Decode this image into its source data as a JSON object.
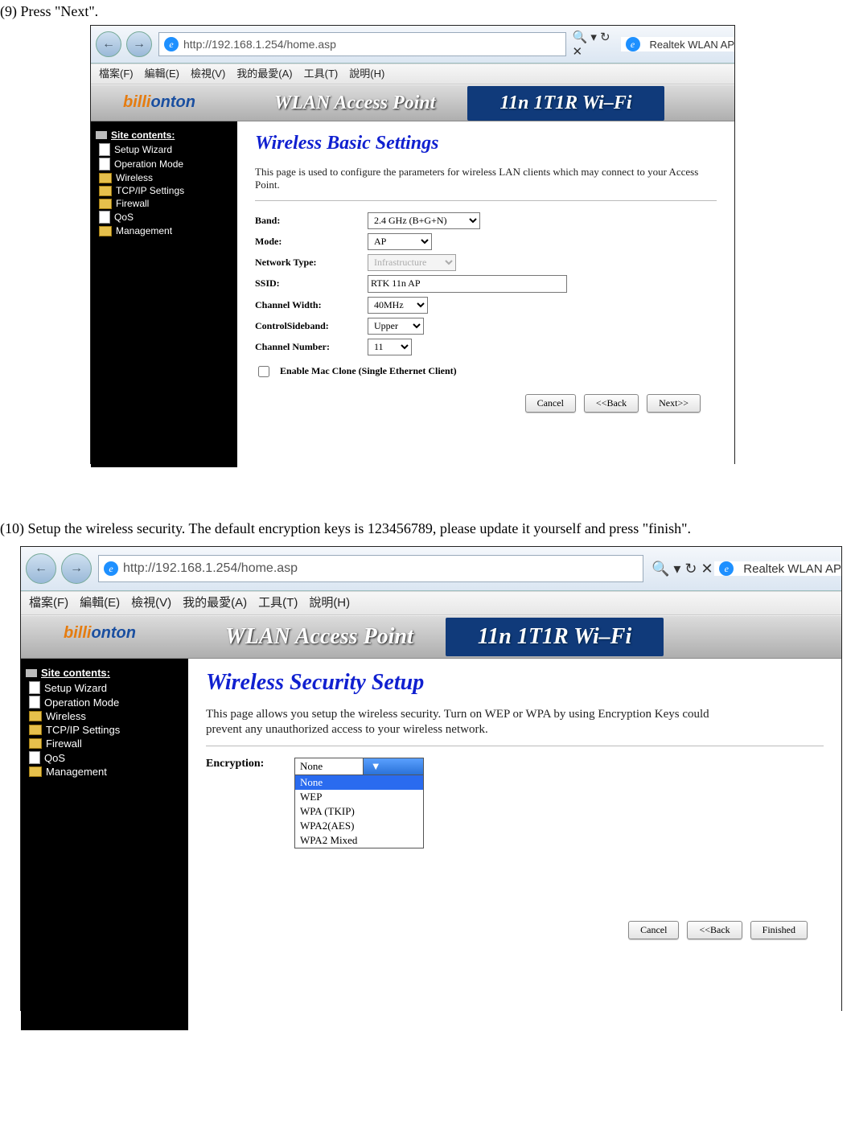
{
  "step9": "(9) Press \"Next\".",
  "step10": "(10) Setup the wireless security. The default encryption keys is 123456789, please update it yourself and press \"finish\".",
  "url": "http://192.168.1.254/home.asp",
  "tab_title": "Realtek WLAN AP",
  "menu": {
    "file": "檔案(F)",
    "edit": "編輯(E)",
    "view": "檢視(V)",
    "fav": "我的最愛(A)",
    "tools": "工具(T)",
    "help": "說明(H)"
  },
  "brand": {
    "a": "billi",
    "b": "onton"
  },
  "banner": {
    "left": "WLAN Access Point",
    "right": "11n  1T1R Wi–Fi"
  },
  "sidebar": {
    "title": "Site contents:",
    "items": [
      {
        "label": "Setup Wizard",
        "type": "pg"
      },
      {
        "label": "Operation Mode",
        "type": "pg"
      },
      {
        "label": "Wireless",
        "type": "fd"
      },
      {
        "label": "TCP/IP Settings",
        "type": "fd"
      },
      {
        "label": "Firewall",
        "type": "fd"
      },
      {
        "label": "QoS",
        "type": "pg"
      },
      {
        "label": "Management",
        "type": "fd"
      }
    ]
  },
  "page1": {
    "title": "Wireless  Basic Settings",
    "desc": "This page is used to configure the parameters for wireless LAN clients which may connect to your Access Point.",
    "fields": {
      "band": {
        "label": "Band:",
        "value": "2.4 GHz (B+G+N)"
      },
      "mode": {
        "label": "Mode:",
        "value": "AP"
      },
      "ntype": {
        "label": "Network Type:",
        "value": "Infrastructure"
      },
      "ssid": {
        "label": "SSID:",
        "value": "RTK 11n AP"
      },
      "cw": {
        "label": "Channel Width:",
        "value": "40MHz"
      },
      "cs": {
        "label": "ControlSideband:",
        "value": "Upper"
      },
      "cn": {
        "label": "Channel Number:",
        "value": "11"
      }
    },
    "mac_clone": "Enable Mac Clone (Single Ethernet Client)",
    "buttons": {
      "cancel": "Cancel",
      "back": "<<Back",
      "next": "Next>>"
    }
  },
  "page2": {
    "title": "Wireless  Security Setup",
    "desc": "This page allows you setup the wireless security. Turn on WEP or WPA by using Encryption Keys could prevent any unauthorized access to your wireless network.",
    "enc_label": "Encryption:",
    "enc_selected": "None",
    "enc_options": [
      "None",
      "WEP",
      "WPA (TKIP)",
      "WPA2(AES)",
      "WPA2 Mixed"
    ],
    "buttons": {
      "cancel": "Cancel",
      "back": "<<Back",
      "finish": "Finished"
    }
  }
}
